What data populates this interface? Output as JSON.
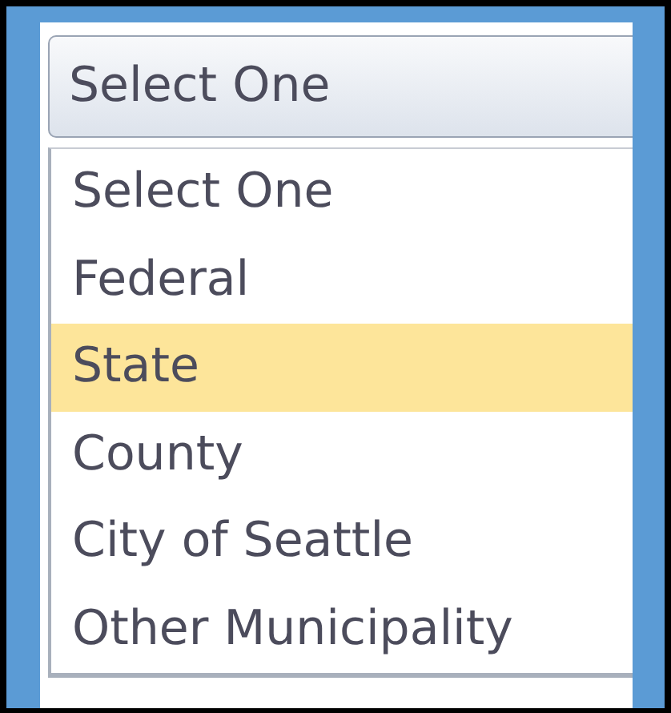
{
  "dropdown": {
    "value": "Select One"
  },
  "options": [
    {
      "label": "Select One",
      "selected": false
    },
    {
      "label": "Federal",
      "selected": false
    },
    {
      "label": "State",
      "selected": true
    },
    {
      "label": "County",
      "selected": false
    },
    {
      "label": "City of Seattle",
      "selected": false
    },
    {
      "label": "Other Municipality",
      "selected": false
    }
  ]
}
